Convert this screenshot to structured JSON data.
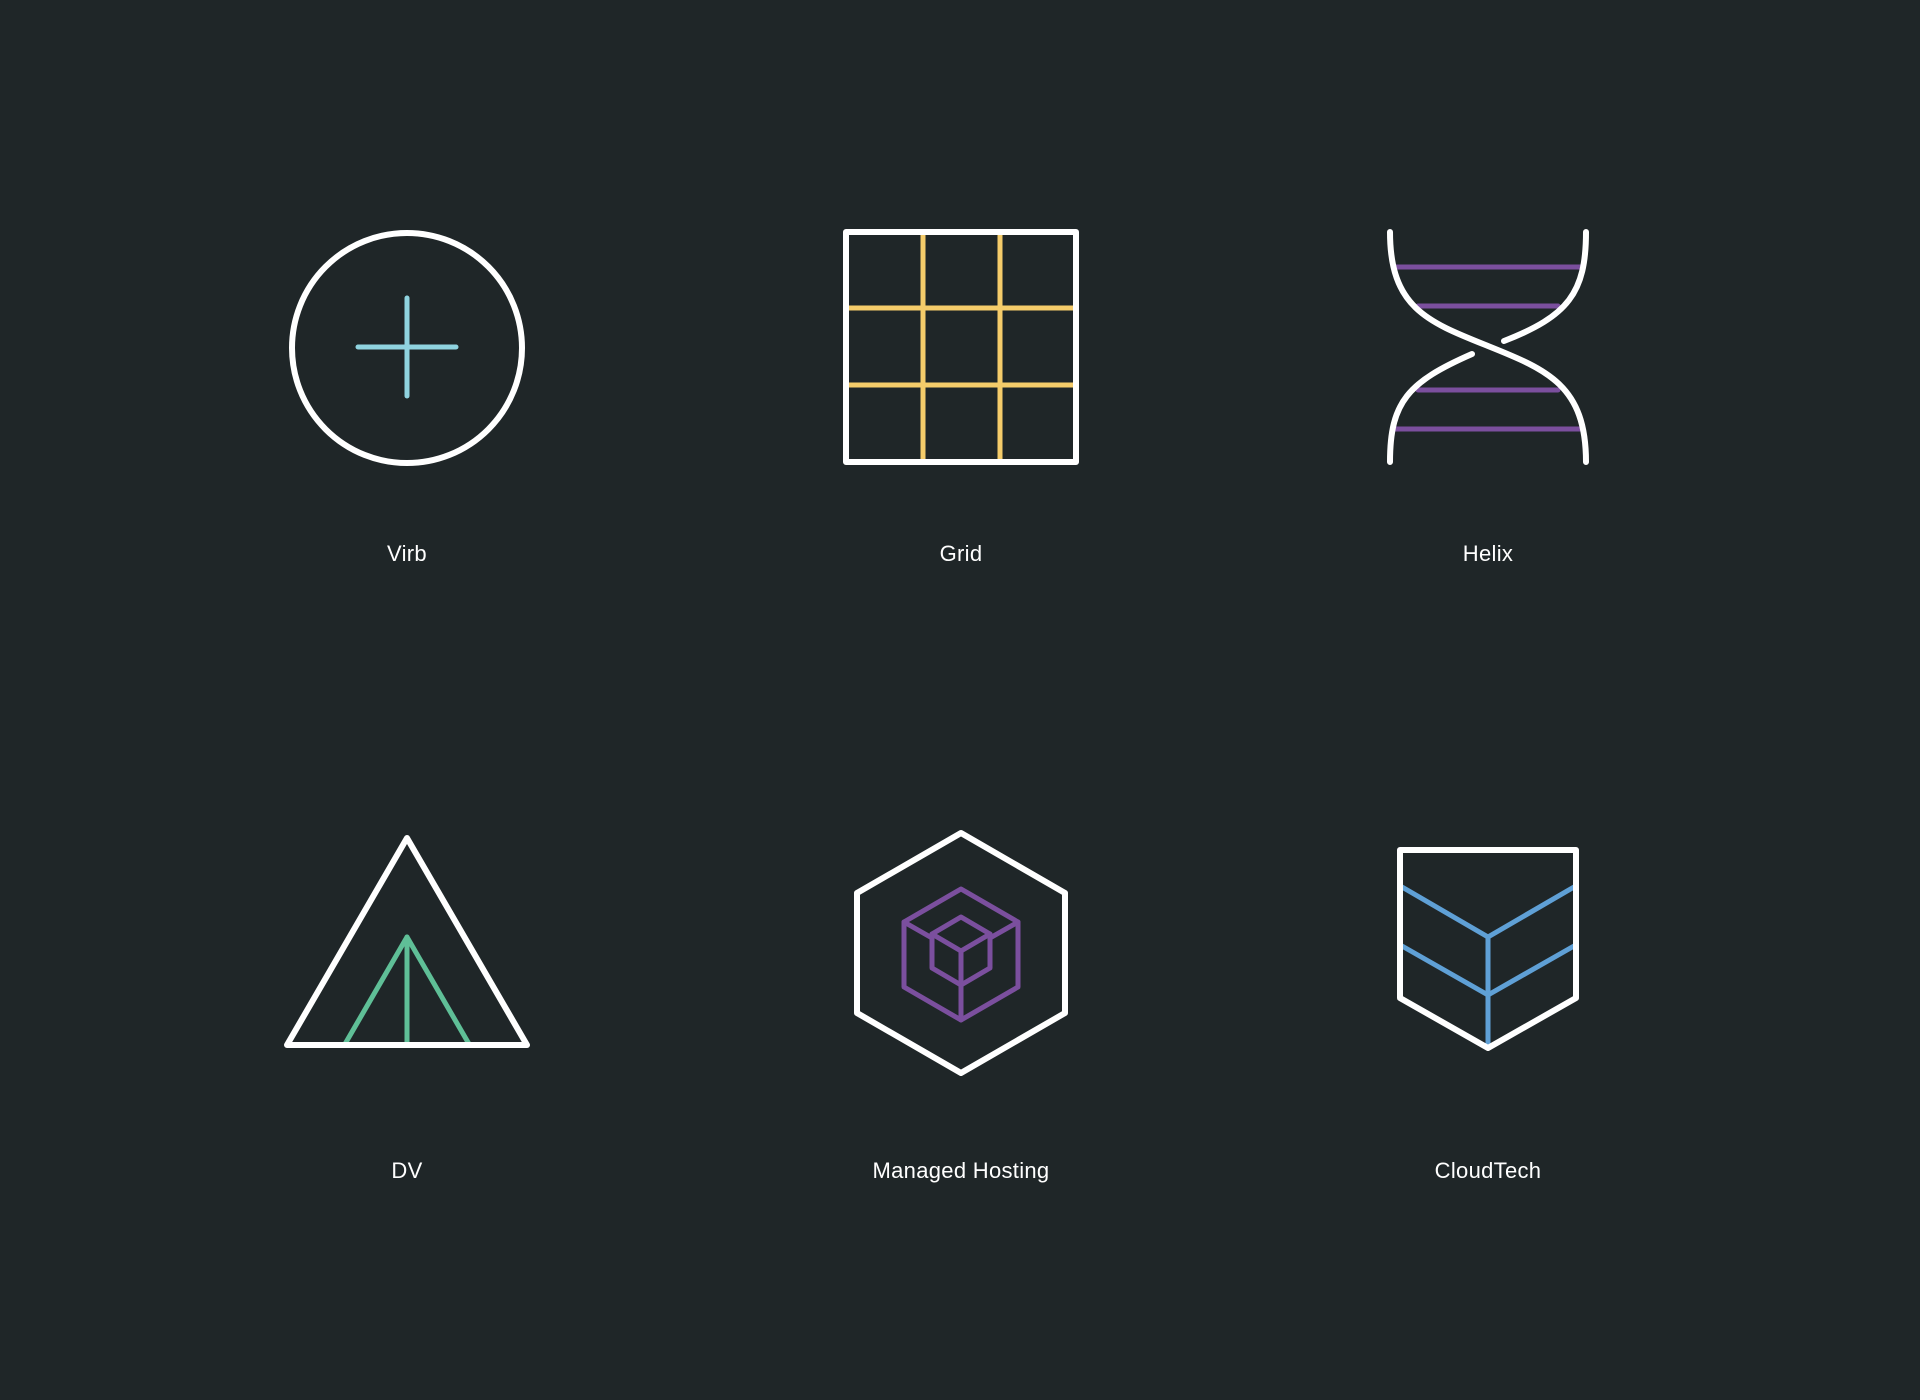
{
  "background_color": "#1f2628",
  "line_color": "#ffffff",
  "logos": [
    {
      "label": "Virb",
      "icon": "circle-plus-icon",
      "accent": "#8fd3df"
    },
    {
      "label": "Grid",
      "icon": "grid-icon",
      "accent": "#f5cc6a"
    },
    {
      "label": "Helix",
      "icon": "dna-helix-icon",
      "accent": "#7b4f9e"
    },
    {
      "label": "DV",
      "icon": "triangle-tent-icon",
      "accent": "#5fbf97"
    },
    {
      "label": "Managed Hosting",
      "icon": "hexagon-cube-icon",
      "accent": "#7b4f9e"
    },
    {
      "label": "CloudTech",
      "icon": "shield-chevron-icon",
      "accent": "#5fa0d6"
    }
  ]
}
